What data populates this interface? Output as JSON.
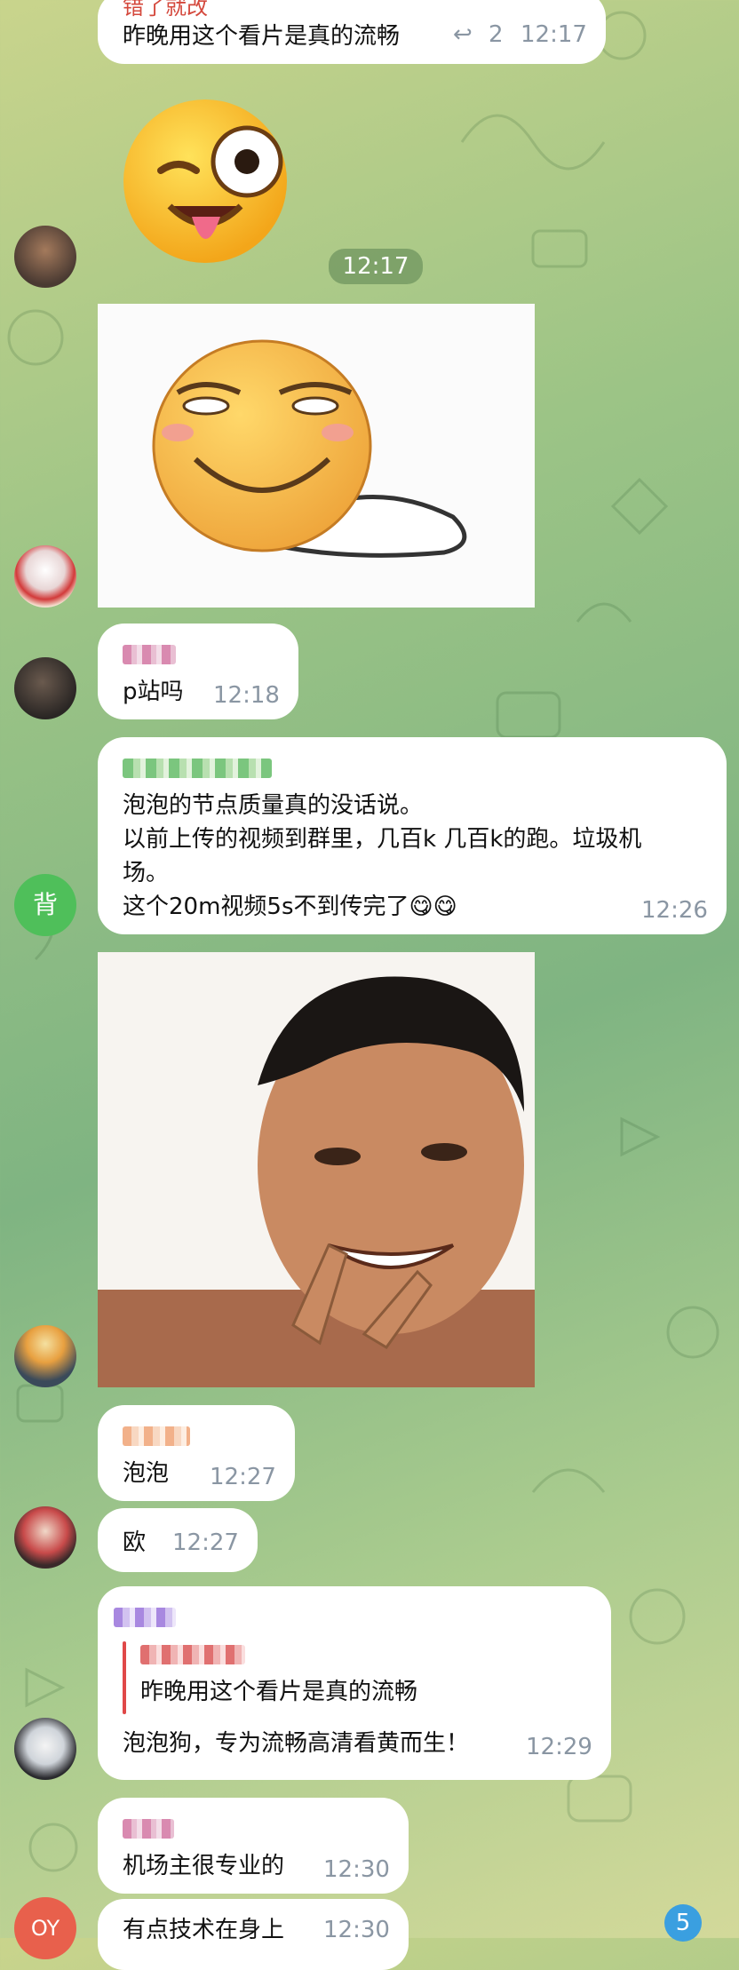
{
  "messages": {
    "m1": {
      "sender_partial": "错了就改",
      "text": "昨晚用这个看片是真的流畅",
      "reply_count": "2",
      "time": "12:17"
    },
    "sticker1": {
      "time": "12:17"
    },
    "m2": {
      "text": "p站吗",
      "time": "12:18"
    },
    "m3": {
      "line1": "泡泡的节点质量真的没话说。",
      "line2": "以前上传的视频到群里，几百k 几百k的跑。垃圾机",
      "line3": "场。",
      "line4": "这个20m视频5s不到传完了😋😋",
      "time": "12:26",
      "avatar_letter": "背"
    },
    "m4": {
      "text": "泡泡",
      "time": "12:27"
    },
    "m5": {
      "text": "欧",
      "time": "12:27"
    },
    "m6": {
      "quoted_text": "昨晚用这个看片是真的流畅",
      "text": "泡泡狗，专为流畅高清看黄而生！",
      "time": "12:29"
    },
    "m7": {
      "text": "机场主很专业的",
      "time": "12:30"
    },
    "m8": {
      "text": "有点技术在身上",
      "time": "12:30",
      "avatar_letter": "OY"
    }
  },
  "unread_badge": "5",
  "colors": {
    "avatar_green": "#4fbf5a",
    "avatar_red": "#e8604c",
    "badge": "#3a9fe0",
    "reply_accent": "#e04848"
  }
}
